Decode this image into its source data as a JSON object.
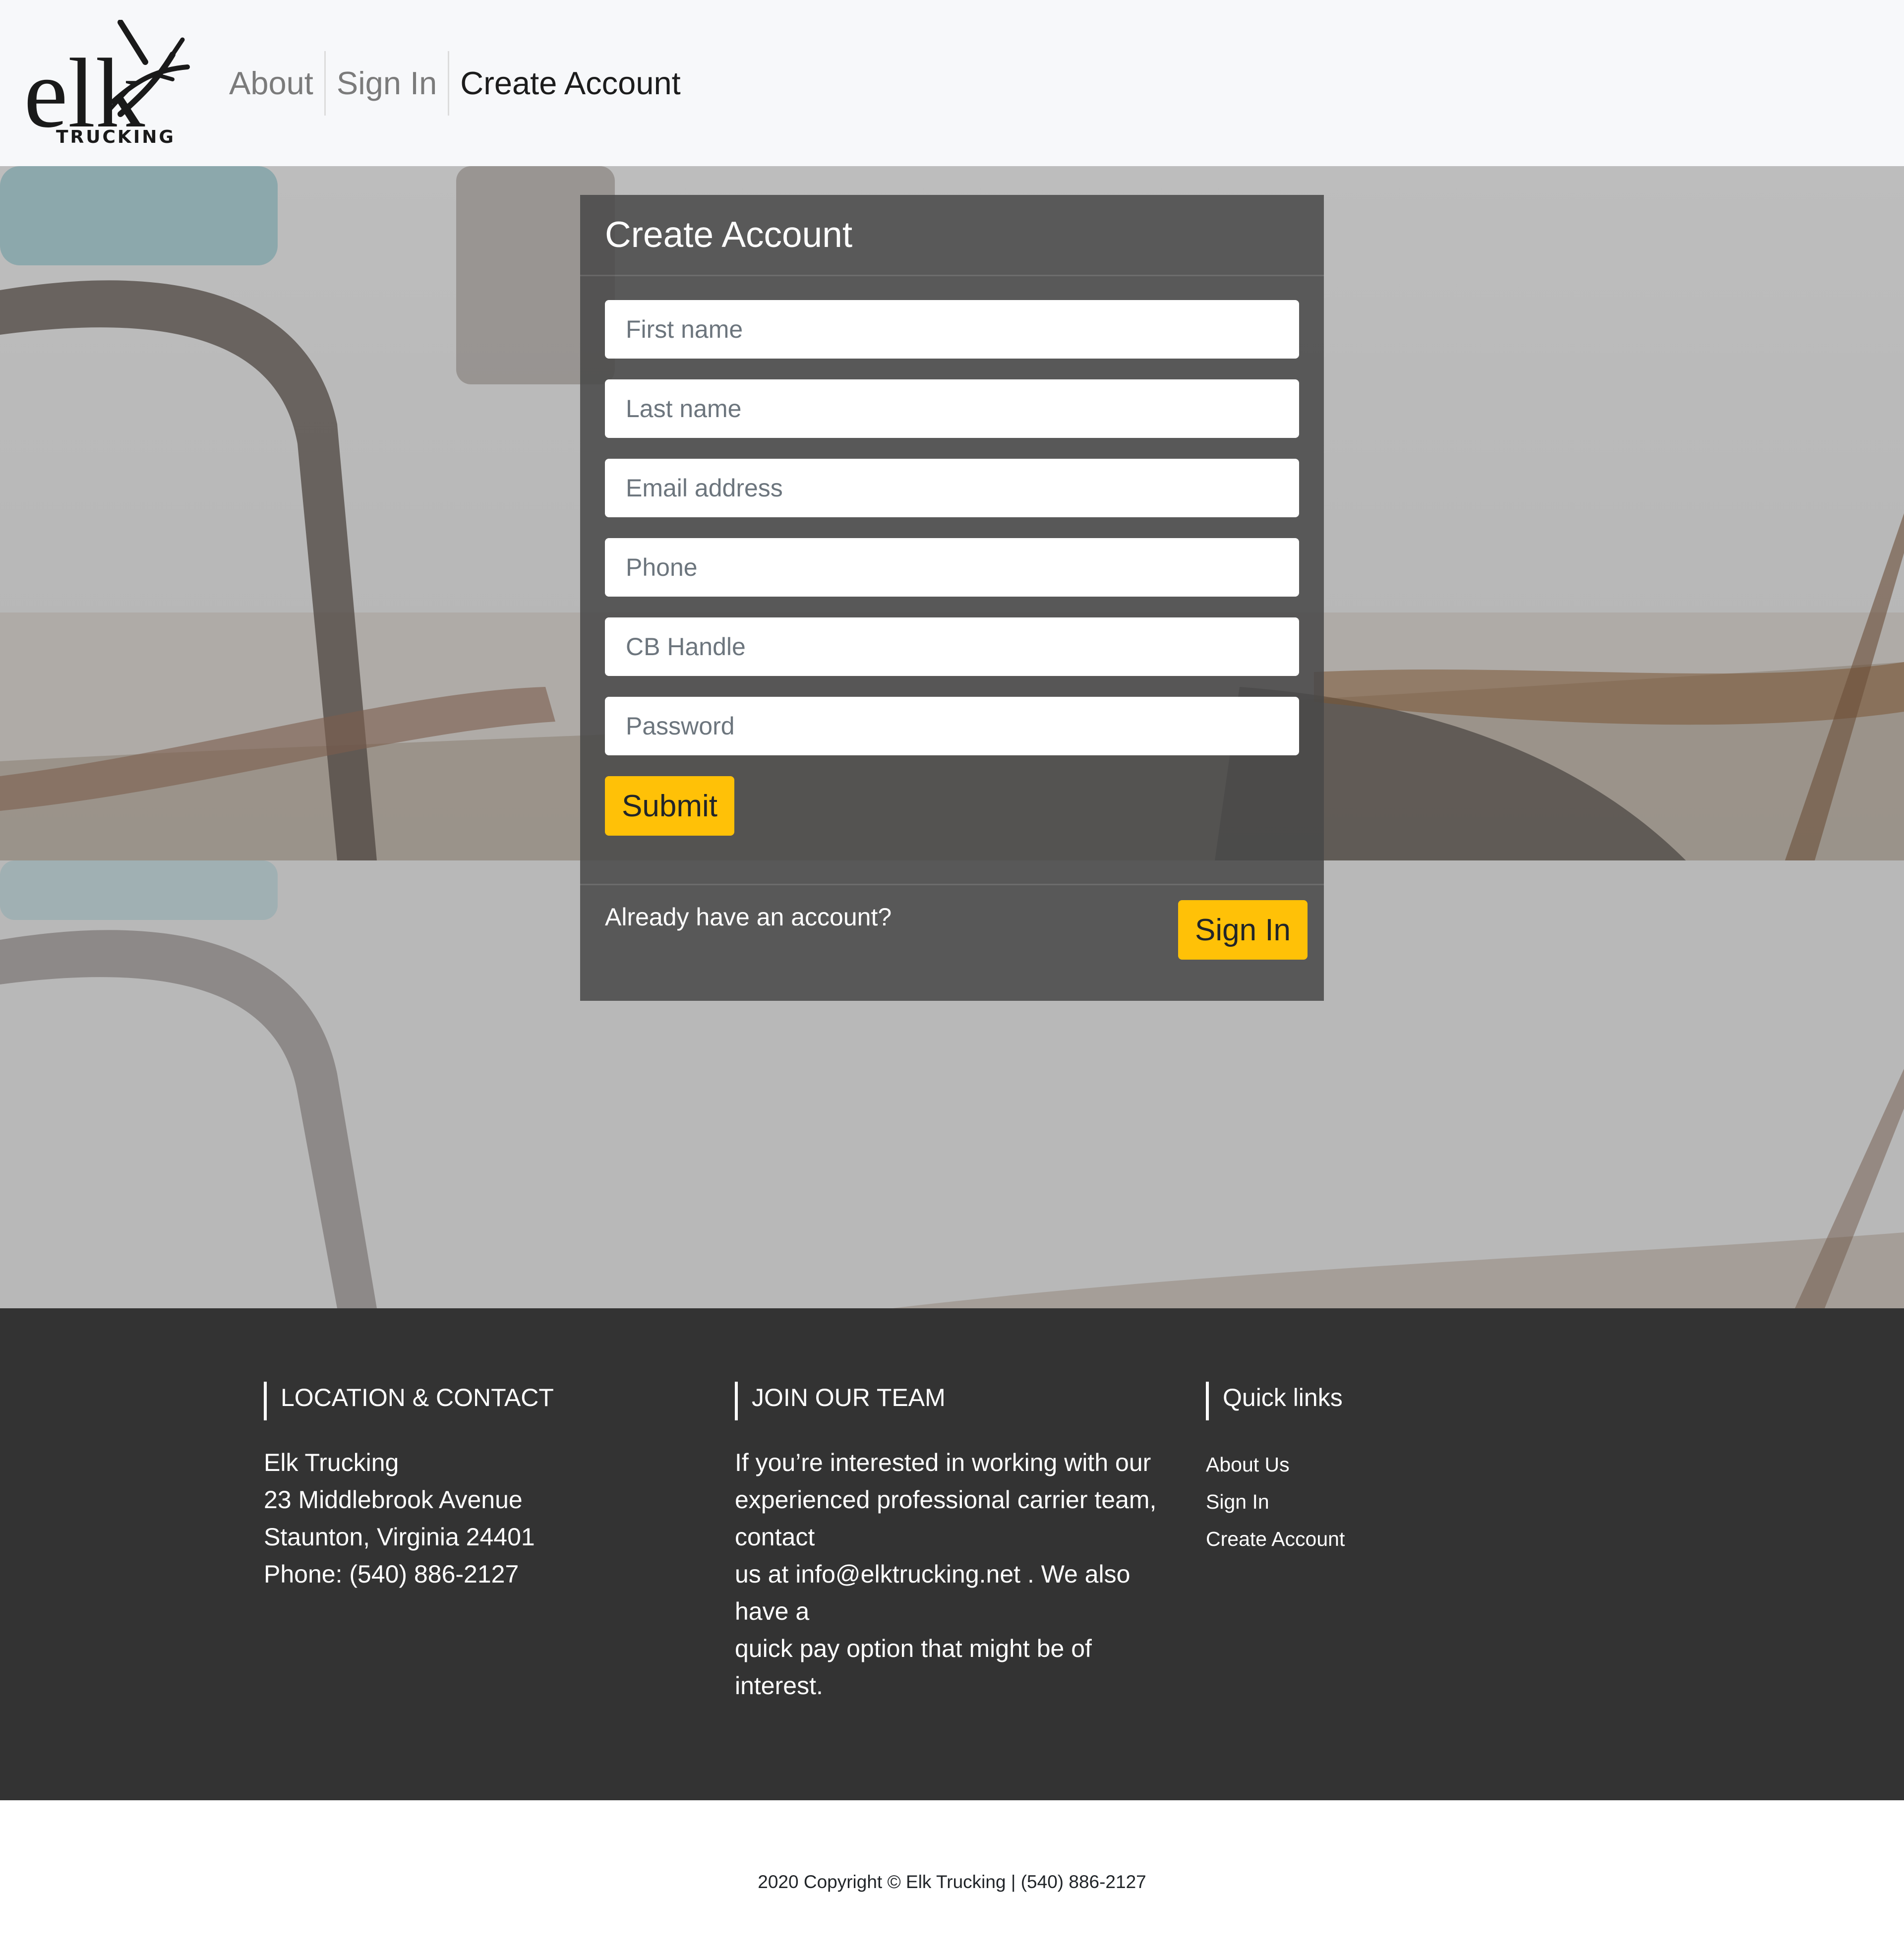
{
  "brand": {
    "logo_word": "elk",
    "logo_sub": "TRUCKING"
  },
  "nav": {
    "items": [
      {
        "label": "About",
        "active": false
      },
      {
        "label": "Sign In",
        "active": false
      },
      {
        "label": "Create Account",
        "active": true
      }
    ]
  },
  "form": {
    "title": "Create Account",
    "fields": [
      {
        "placeholder": "First name",
        "value": ""
      },
      {
        "placeholder": "Last name",
        "value": ""
      },
      {
        "placeholder": "Email address",
        "value": ""
      },
      {
        "placeholder": "Phone",
        "value": ""
      },
      {
        "placeholder": "CB Handle",
        "value": ""
      },
      {
        "placeholder": "Password",
        "value": ""
      }
    ],
    "submit_label": "Submit",
    "already_text": "Already have an account?",
    "signin_label": "Sign In"
  },
  "footer": {
    "location": {
      "heading": "LOCATION & CONTACT",
      "lines": [
        "Elk Trucking",
        "23 Middlebrook Avenue",
        "Staunton, Virginia 24401",
        "Phone: (540) 886-2127"
      ]
    },
    "join": {
      "heading": "JOIN OUR TEAM",
      "lines": [
        "If you’re interested in working with our",
        "experienced professional carrier team,",
        "contact",
        "us at info@elktrucking.net . We also",
        "have a",
        "quick pay option that might be of",
        "interest."
      ]
    },
    "quick_links": {
      "heading": "Quick links",
      "items": [
        "About Us",
        "Sign In",
        "Create Account"
      ]
    },
    "copyright": "2020 Copyright © Elk Trucking | (540) 886-2127"
  },
  "colors": {
    "accent": "#ffc107",
    "footer_bg": "#333333",
    "navbar_bg": "#f7f8fa",
    "card_bg": "#484848"
  }
}
